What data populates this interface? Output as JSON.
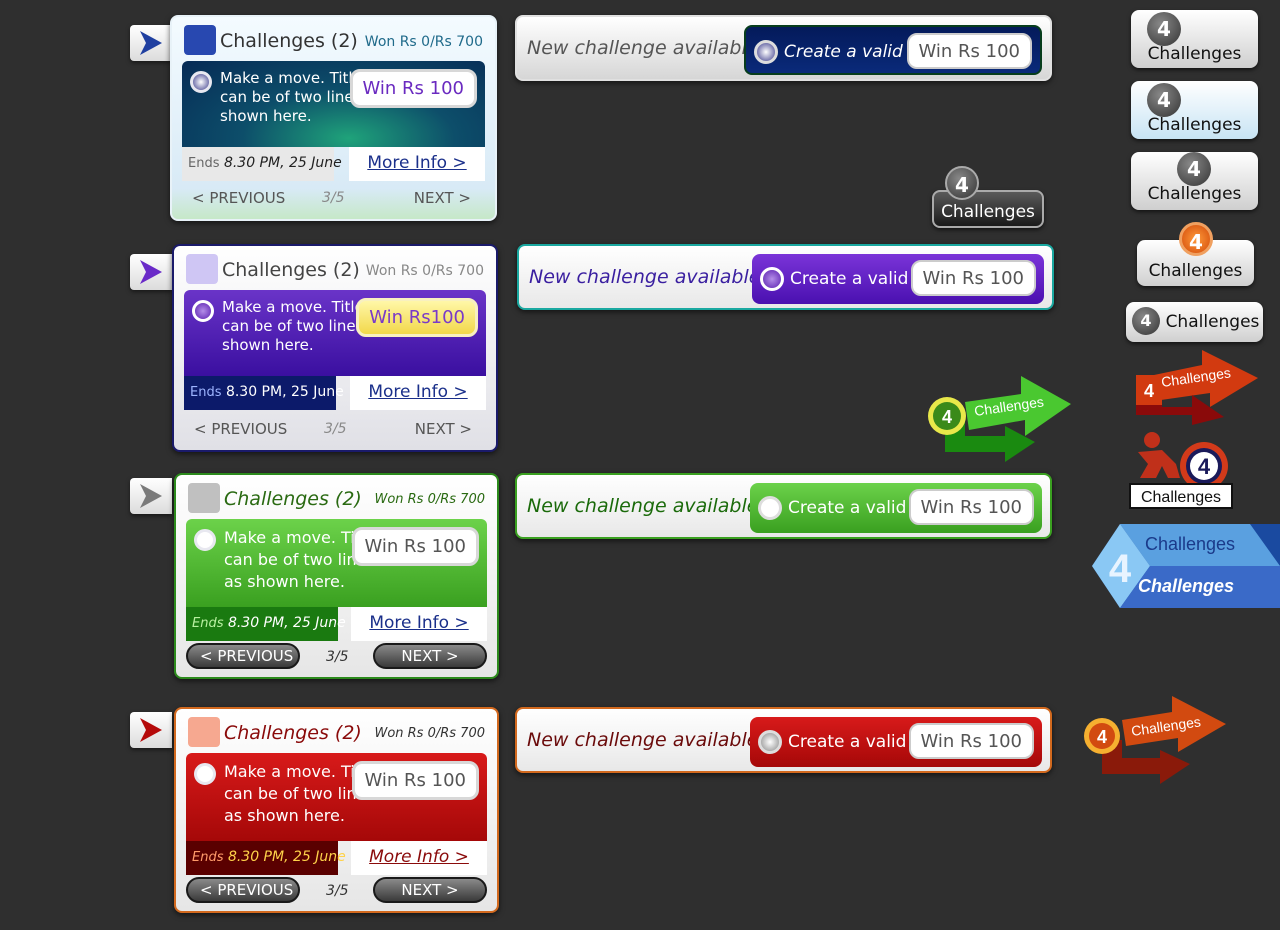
{
  "widgets": [
    {
      "title": "Challenges (2)",
      "won": "Won Rs 0/Rs 700",
      "message": "Make a move. Title can be of two lines as shown here.",
      "win": "Win Rs 100",
      "ends_label": "Ends",
      "ends_time": "8.30 PM, 25 June",
      "more_info": "More Info >",
      "prev": "< PREVIOUS",
      "page": "3/5",
      "next": "NEXT >"
    },
    {
      "title": "Challenges (2)",
      "won": "Won Rs 0/Rs 700",
      "message": "Make a move. Title can be of two lines as shown here.",
      "win": "Win Rs100",
      "ends_label": "Ends",
      "ends_time": "8.30 PM, 25 June",
      "more_info": "More Info >",
      "prev": "< PREVIOUS",
      "page": "3/5",
      "next": "NEXT >"
    },
    {
      "title": "Challenges (2)",
      "won": "Won Rs 0/Rs 700",
      "message": "Make a move. Title can be of two lines as shown here.",
      "win": "Win Rs 100",
      "ends_label": "Ends",
      "ends_time": "8.30 PM, 25 June",
      "more_info": "More Info >",
      "prev": "< PREVIOUS",
      "page": "3/5",
      "next": "NEXT >"
    },
    {
      "title": "Challenges (2)",
      "won": "Won Rs 0/Rs 700",
      "message": "Make a move. Title can be of two lines as shown here.",
      "win": "Win Rs 100",
      "ends_label": "Ends",
      "ends_time": "8.30 PM, 25 June",
      "more_info": "More Info >",
      "prev": "< PREVIOUS",
      "page": "3/5",
      "next": "NEXT >"
    }
  ],
  "bars": [
    {
      "text": "New challenge available",
      "cta": "Create a valid Set",
      "win": "Win Rs 100"
    },
    {
      "text": "New challenge available",
      "cta": "Create a valid Set",
      "win": "Win Rs 100"
    },
    {
      "text": "New challenge available",
      "cta": "Create a valid Set",
      "win": "Win Rs 100"
    },
    {
      "text": "New challenge available",
      "cta": "Create a valid Set",
      "win": "Win Rs 100"
    }
  ],
  "badges": {
    "count": "4",
    "label": "Challenges"
  },
  "colors": {
    "blue": "#0b3c66",
    "purple": "#5a1fb0",
    "green": "#3aa020",
    "red": "#b50a0a"
  }
}
